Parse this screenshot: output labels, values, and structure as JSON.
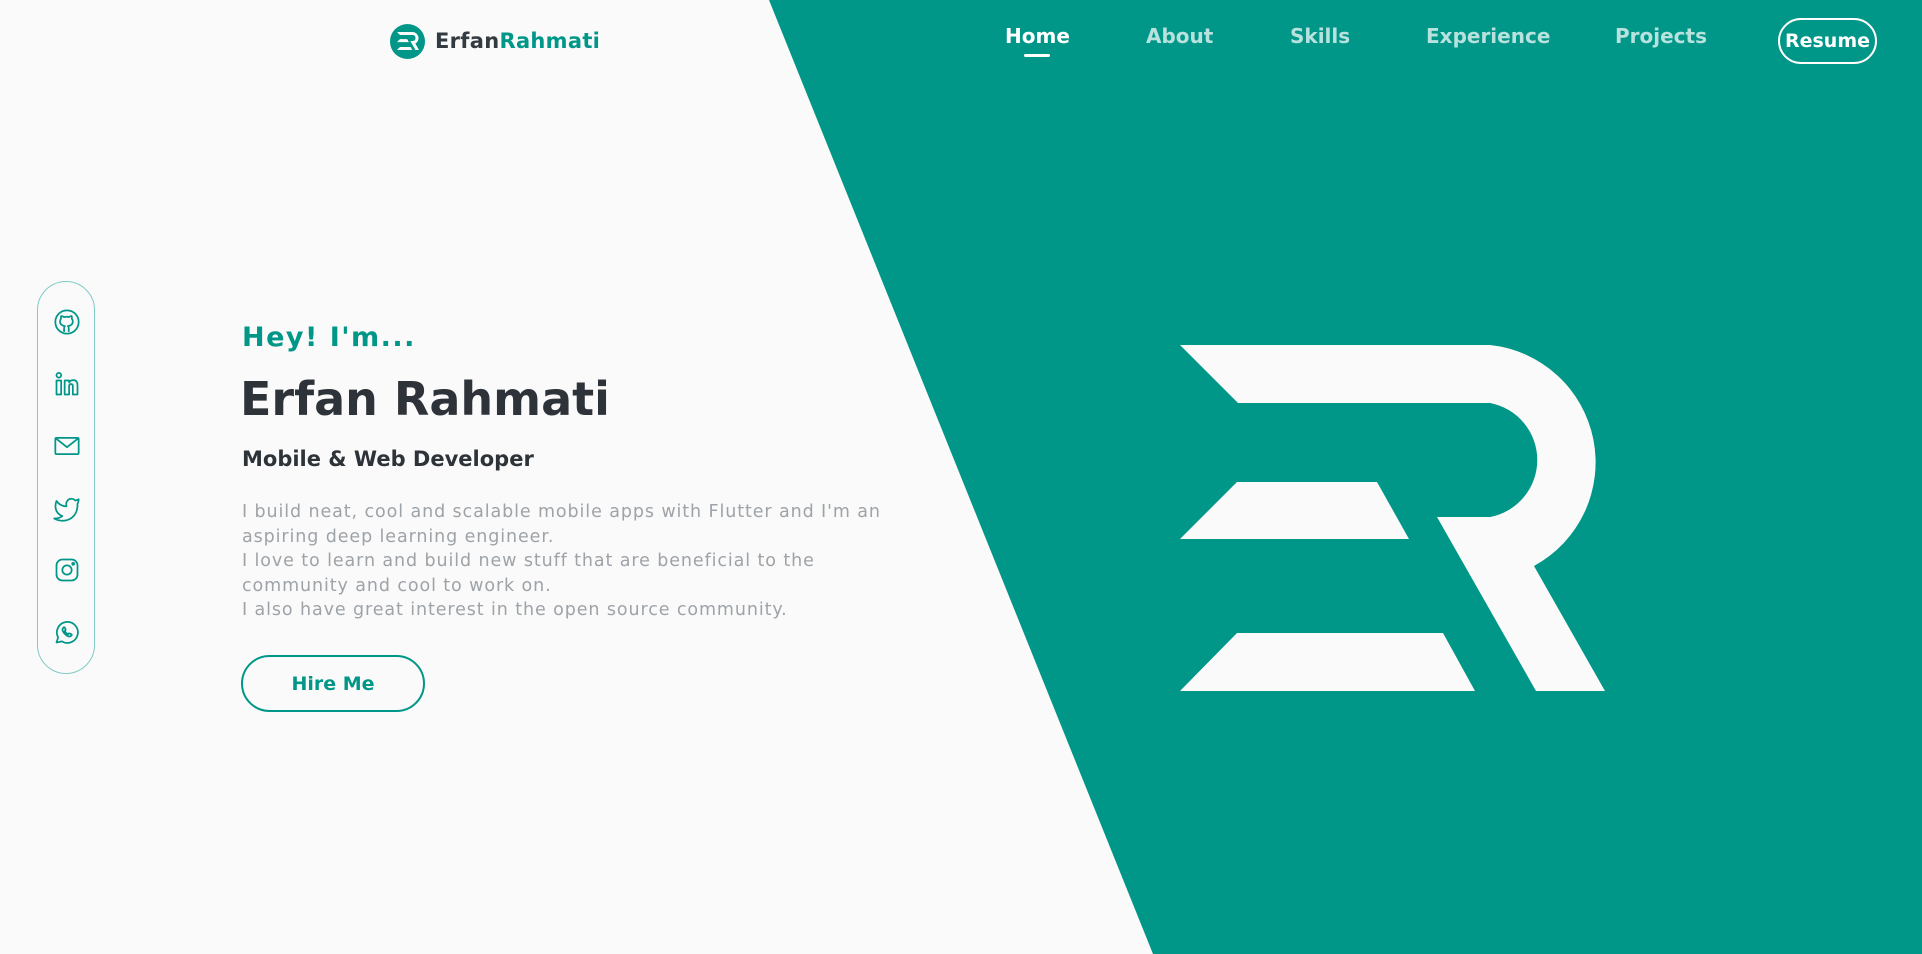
{
  "brand": {
    "first": "Erfan",
    "last": "Rahmati",
    "logo_icon": "er-logo-icon"
  },
  "nav": {
    "items": [
      {
        "label": "Home",
        "active": true
      },
      {
        "label": "About",
        "active": false
      },
      {
        "label": "Skills",
        "active": false
      },
      {
        "label": "Experience",
        "active": false
      },
      {
        "label": "Projects",
        "active": false
      }
    ],
    "resume_label": "Resume"
  },
  "social": {
    "icons": [
      "github-icon",
      "linkedin-icon",
      "mail-icon",
      "twitter-icon",
      "instagram-icon",
      "whatsapp-icon"
    ]
  },
  "hero": {
    "greeting": "Hey! I'm...",
    "name": "Erfan Rahmati",
    "role": "Mobile & Web Developer",
    "bio": [
      "I build neat, cool and scalable mobile apps with Flutter and I'm an aspiring deep learning engineer.",
      "I love to learn and build new stuff that are beneficial to the community and cool to work on.",
      "I also have great interest in the open source community."
    ],
    "cta_label": "Hire Me"
  },
  "colors": {
    "accent": "#009688",
    "background": "#fafafa",
    "heading": "#2d3338",
    "muted": "#9ea3a8",
    "sidebar_border": "#80cbc4"
  }
}
